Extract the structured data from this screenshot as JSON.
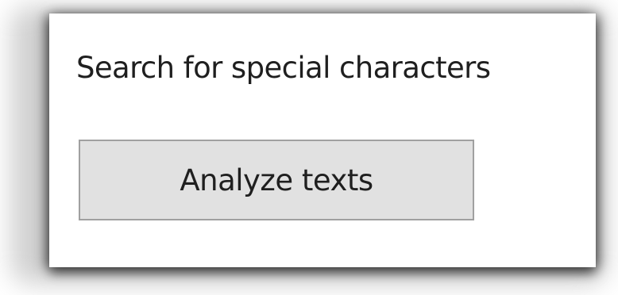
{
  "panel": {
    "heading": "Search for special characters",
    "analyze_button_label": "Analyze texts"
  },
  "colors": {
    "button_background": "#e1e1e1",
    "button_border": "#a0a0a0",
    "text": "#1f1f1f",
    "panel_background": "#ffffff"
  }
}
